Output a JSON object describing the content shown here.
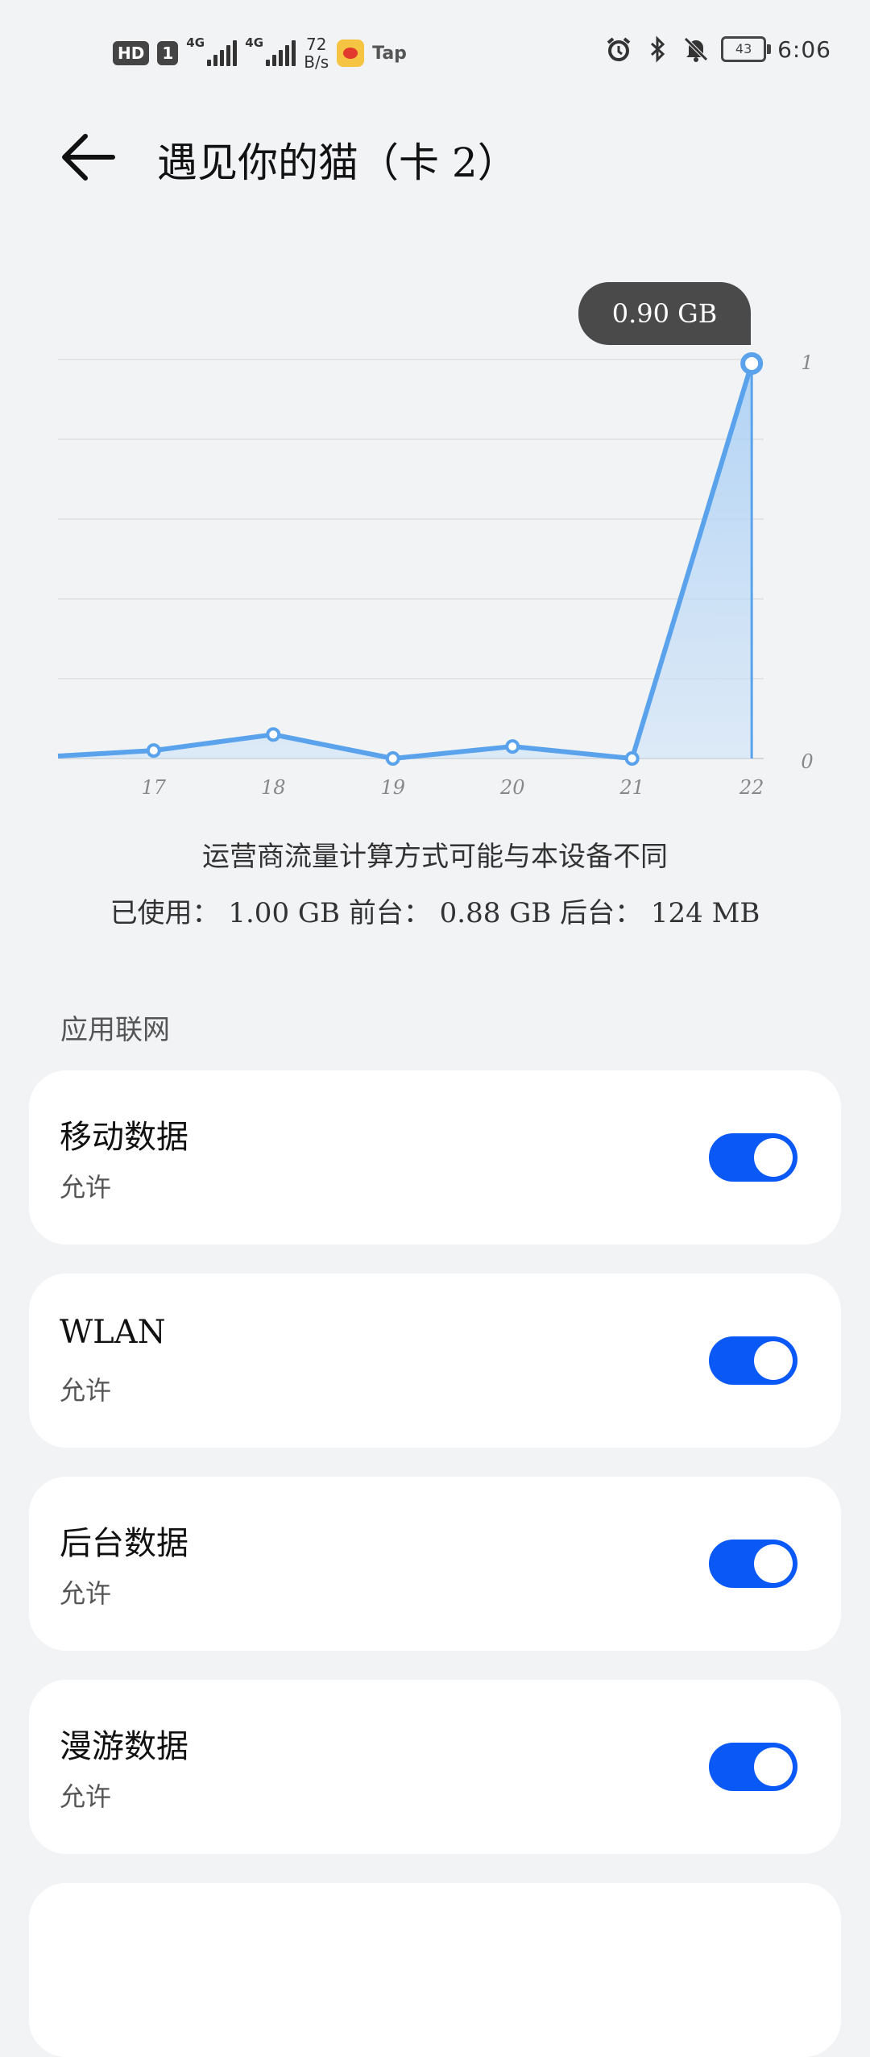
{
  "status_bar": {
    "badge_hd": "HD",
    "badge_sim": "1",
    "net1": "4G",
    "net2": "4G",
    "speed_value": "72",
    "speed_unit": "B/s",
    "tap_label": "Tap",
    "battery": "43",
    "time": "6:06"
  },
  "header": {
    "title": "遇见你的猫（卡 2）",
    "back_icon": "arrow-left-icon"
  },
  "chart_data": {
    "type": "area",
    "x": [
      17,
      18,
      19,
      20,
      21,
      22
    ],
    "x_tick_labels": [
      "17",
      "18",
      "19",
      "20",
      "21",
      "22"
    ],
    "values": [
      0.02,
      0.06,
      0.0,
      0.03,
      0.0,
      0.99
    ],
    "y_tick_labels": [
      "1",
      "0"
    ],
    "ylim": [
      0,
      1
    ],
    "tooltip": "0.90 GB",
    "grid": true,
    "color": "#5aa3ec"
  },
  "notes": {
    "line1": "运营商流量计算方式可能与本设备不同",
    "line2": "已使用： 1.00 GB 前台： 0.88 GB 后台： 124 MB"
  },
  "section": {
    "label": "应用联网"
  },
  "settings": [
    {
      "title": "移动数据",
      "subtitle": "允许",
      "enabled": true
    },
    {
      "title": "WLAN",
      "subtitle": "允许",
      "enabled": true
    },
    {
      "title": "后台数据",
      "subtitle": "允许",
      "enabled": true
    },
    {
      "title": "漫游数据",
      "subtitle": "允许",
      "enabled": true
    }
  ],
  "colors": {
    "accent": "#0a59f7",
    "background": "#f1f3f5",
    "card": "#ffffff"
  }
}
